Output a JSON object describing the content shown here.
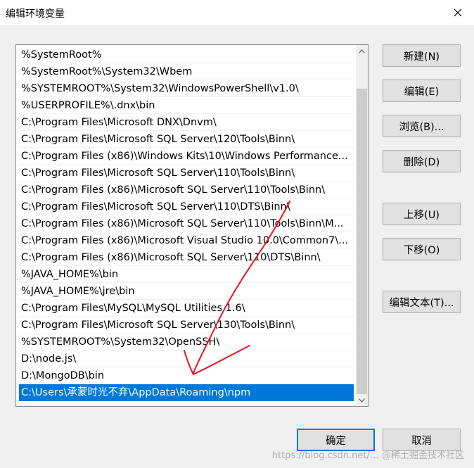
{
  "window": {
    "title": "编辑环境变量"
  },
  "path_list": {
    "items": [
      "%SystemRoot%",
      "%SystemRoot%\\System32\\Wbem",
      "%SYSTEMROOT%\\System32\\WindowsPowerShell\\v1.0\\",
      "%USERPROFILE%\\.dnx\\bin",
      "C:\\Program Files\\Microsoft DNX\\Dnvm\\",
      "C:\\Program Files\\Microsoft SQL Server\\120\\Tools\\Binn\\",
      "C:\\Program Files (x86)\\Windows Kits\\10\\Windows Performance...",
      "C:\\Program Files\\Microsoft SQL Server\\110\\Tools\\Binn\\",
      "C:\\Program Files (x86)\\Microsoft SQL Server\\110\\Tools\\Binn\\",
      "C:\\Program Files\\Microsoft SQL Server\\110\\DTS\\Binn\\",
      "C:\\Program Files (x86)\\Microsoft SQL Server\\110\\Tools\\Binn\\M...",
      "C:\\Program Files (x86)\\Microsoft Visual Studio 10.0\\Common7\\...",
      "C:\\Program Files (x86)\\Microsoft SQL Server\\110\\DTS\\Binn\\",
      "%JAVA_HOME%\\bin",
      "%JAVA_HOME%\\jre\\bin",
      "C:\\Program Files\\MySQL\\MySQL Utilities 1.6\\",
      "C:\\Program Files\\Microsoft SQL Server\\130\\Tools\\Binn\\",
      "%SYSTEMROOT%\\System32\\OpenSSH\\",
      "D:\\node.js\\",
      "D:\\MongoDB\\bin",
      "C:\\Users\\承蒙时光不弃\\AppData\\Roaming\\npm"
    ],
    "selected_index": 20
  },
  "buttons": {
    "new": "新建(N)",
    "edit": "编辑(E)",
    "browse": "浏览(B)...",
    "delete": "删除(D)",
    "move_up": "上移(U)",
    "move_down": "下移(O)",
    "edit_text": "编辑文本(T)...",
    "ok": "确定",
    "cancel": "取消"
  },
  "watermark": "https://blog.csdn.net/… @稀土掘金技术社区",
  "colors": {
    "selection": "#0078d7",
    "annotation": "#e8141c"
  },
  "icons": {
    "close": "close-icon",
    "scroll_up": "chevron-up-icon",
    "scroll_down": "chevron-down-icon"
  }
}
